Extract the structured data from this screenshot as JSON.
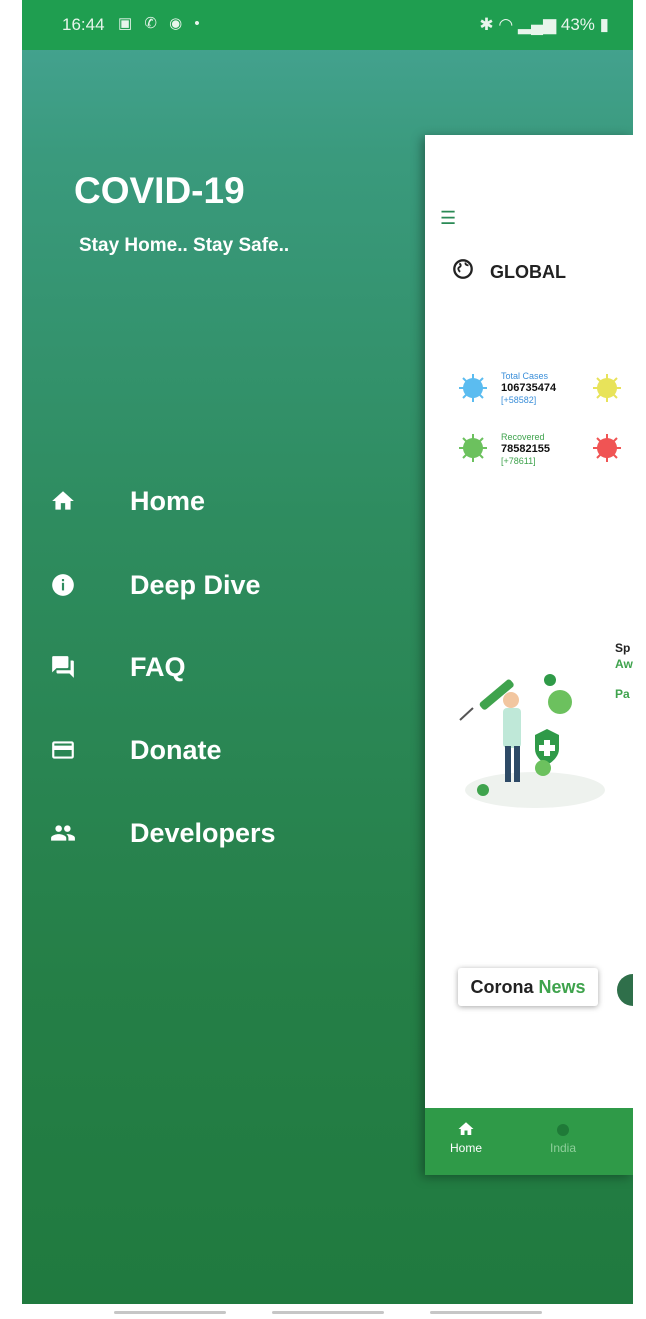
{
  "statusbar": {
    "time": "16:44",
    "battery": "43%"
  },
  "drawer": {
    "title": "COVID-19",
    "subtitle": "Stay Home.. Stay Safe..",
    "items": [
      {
        "label": "Home",
        "icon": "home-icon"
      },
      {
        "label": "Deep Dive",
        "icon": "info-icon"
      },
      {
        "label": "FAQ",
        "icon": "forum-icon"
      },
      {
        "label": "Donate",
        "icon": "credit-card-icon"
      },
      {
        "label": "Developers",
        "icon": "people-icon"
      }
    ]
  },
  "panel": {
    "global_label": "GLOBAL",
    "stats": [
      {
        "label": "Total Cases",
        "value": "106735474",
        "delta": "[+58582]",
        "label_color": "#3b8fd9"
      },
      {
        "label": "Recovered",
        "value": "78582155",
        "delta": "[+78611]",
        "label_color": "#3fa34d"
      }
    ],
    "awareness_lines": [
      "Sp",
      "Aw",
      "Pa"
    ],
    "news": {
      "part1": "Corona",
      "part2": "News"
    },
    "bottom_nav": [
      {
        "label": "Home",
        "icon": "home-icon"
      },
      {
        "label": "India",
        "icon": "india-icon"
      }
    ]
  },
  "colors": {
    "status_bar": "#1f9e50",
    "drawer_top": "#47a595",
    "drawer_bottom": "#207a3f",
    "accent_green": "#2f9a48"
  }
}
